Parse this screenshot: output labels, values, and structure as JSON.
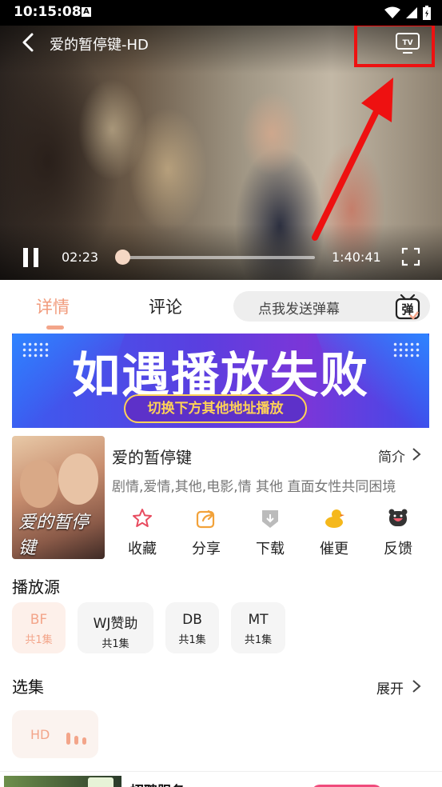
{
  "status_bar": {
    "time": "10:15:08",
    "notification_icon": "A"
  },
  "player": {
    "title": "爱的暂停键-HD",
    "current_time": "02:23",
    "duration": "1:40:41",
    "progress": 0.024
  },
  "tabs": {
    "detail": "详情",
    "comment": "评论"
  },
  "danmu": {
    "placeholder": "点我发送弹幕",
    "icon_char": "弹"
  },
  "banner": {
    "headline": "如遇播放失败",
    "button": "切换下方其他地址播放"
  },
  "movie": {
    "title": "爱的暂停键",
    "intro_label": "简介",
    "tags": "剧情,爱情,其他,电影,情 其他 直面女性共同困境",
    "poster_title": "爱的暂停键"
  },
  "actions": [
    {
      "label": "收藏",
      "icon": "star-icon"
    },
    {
      "label": "分享",
      "icon": "share-icon"
    },
    {
      "label": "下载",
      "icon": "download-icon"
    },
    {
      "label": "催更",
      "icon": "duck-icon"
    },
    {
      "label": "反馈",
      "icon": "feedback-icon"
    }
  ],
  "sources": {
    "title": "播放源",
    "items": [
      {
        "name": "BF",
        "count": "共1集"
      },
      {
        "name": "WJ赞助",
        "count": "共1集"
      },
      {
        "name": "DB",
        "count": "共1集"
      },
      {
        "name": "MT",
        "count": "共1集"
      }
    ]
  },
  "episodes": {
    "title": "选集",
    "expand_label": "展开",
    "items": [
      {
        "label": "HD"
      }
    ]
  },
  "ad": {
    "text": "招聘服务"
  },
  "colors": {
    "accent": "#f3a58a",
    "highlight_box": "#e11111",
    "banner_button_text": "#ffd257"
  }
}
